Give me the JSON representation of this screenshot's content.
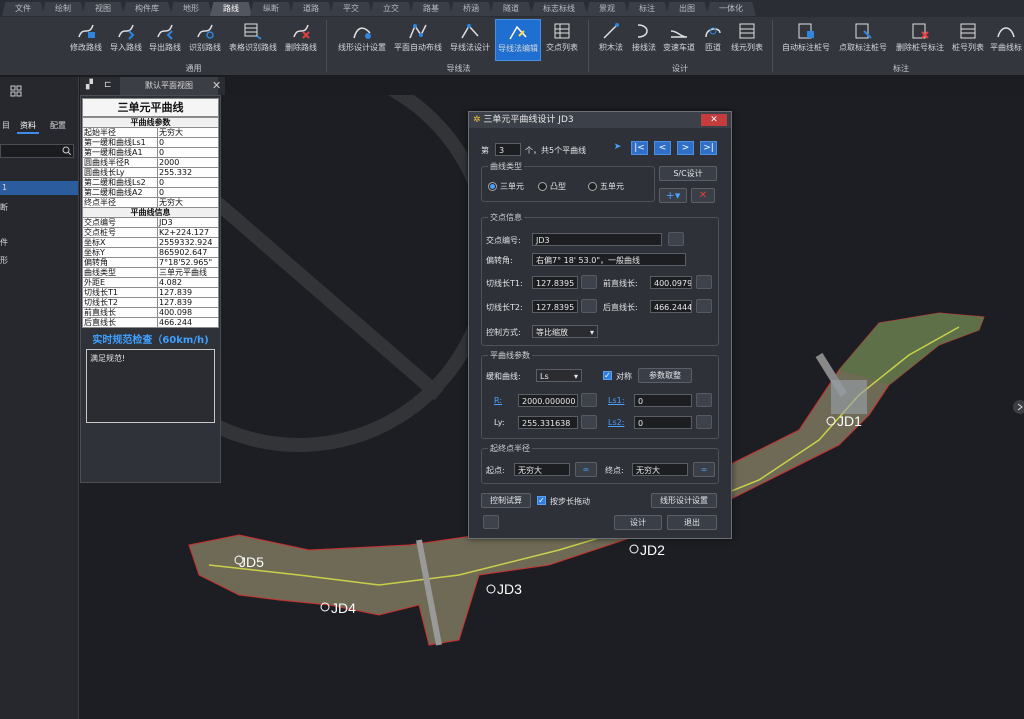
{
  "menu_tabs": [
    "文件",
    "绘制",
    "视图",
    "构件库",
    "地形",
    "路线",
    "纵断",
    "道路",
    "平交",
    "立交",
    "路基",
    "桥涵",
    "隧道",
    "标志标线",
    "景观",
    "标注",
    "出图",
    "一体化"
  ],
  "active_menu": "路线",
  "ribbon": {
    "groups": [
      {
        "label": "通用",
        "buttons": [
          "修改路线",
          "导入路线",
          "导出路线",
          "识别路线",
          "表格识别路线",
          "删除路线"
        ]
      },
      {
        "label": "导线法",
        "buttons": [
          "线形设计设置",
          "平面自动布线",
          "导线法设计",
          "导线法编辑",
          "交点列表"
        ]
      },
      {
        "label": "设计",
        "buttons": [
          "积木法",
          "接线法",
          "变速车道",
          "匝道",
          "线元列表"
        ]
      },
      {
        "label": "标注",
        "buttons": [
          "自动标注桩号",
          "点取标注桩号",
          "删除桩号标注",
          "桩号列表",
          "平曲线标"
        ]
      }
    ],
    "selected_button": "导线法编辑"
  },
  "left_panel": {
    "tabs": [
      "目",
      "资料",
      "配置"
    ],
    "active_tab": "资料",
    "items": [
      "1",
      "断",
      "件",
      "形"
    ]
  },
  "view_tab": {
    "label": "默认平面视图"
  },
  "info_panel": {
    "title": "三单元平曲线",
    "section1": "平曲线参数",
    "params": [
      [
        "起始半径",
        "无穷大"
      ],
      [
        "第一缓和曲线Ls1",
        "0"
      ],
      [
        "第一缓和曲线A1",
        "0"
      ],
      [
        "圆曲线半径R",
        "2000"
      ],
      [
        "圆曲线长Ly",
        "255.332"
      ],
      [
        "第二缓和曲线Ls2",
        "0"
      ],
      [
        "第二缓和曲线A2",
        "0"
      ],
      [
        "终点半径",
        "无穷大"
      ]
    ],
    "section2": "平曲线信息",
    "info": [
      [
        "交点编号",
        "JD3"
      ],
      [
        "交点桩号",
        "K2+224.127"
      ],
      [
        "坐标X",
        "2559332.924"
      ],
      [
        "坐标Y",
        "865902.647"
      ],
      [
        "偏转角",
        "7°18'52.965\""
      ],
      [
        "曲线类型",
        "三单元平曲线"
      ],
      [
        "外距E",
        "4.082"
      ],
      [
        "切线长T1",
        "127.839"
      ],
      [
        "切线长T2",
        "127.839"
      ],
      [
        "前直线长",
        "400.098"
      ],
      [
        "后直线长",
        "466.244"
      ]
    ],
    "check_title": "实时规范检查（60km/h)",
    "check_text": "满足规范!"
  },
  "map_labels": [
    "JD1",
    "JD2",
    "JD3",
    "JD4",
    "JD5"
  ],
  "dialog": {
    "title": "三单元平曲线设计 JD3",
    "page_prefix": "第",
    "page_value": "3",
    "page_suffix": "个，共5个平曲线",
    "curve_type_label": "曲线类型",
    "curve_types": [
      "三单元",
      "凸型",
      "五单元"
    ],
    "curve_type_selected": "三单元",
    "sc_button": "S/C设计",
    "intersection_label": "交点信息",
    "jd_label": "交点编号:",
    "jd_value": "JD3",
    "angle_label": "偏转角:",
    "angle_value": "右偏7° 18' 53.0\"，一般曲线",
    "t1_label": "切线长T1:",
    "t1_value": "127.8395",
    "front_label": "前直线长:",
    "front_value": "400.0979",
    "t2_label": "切线长T2:",
    "t2_value": "127.8395",
    "back_label": "后直线长:",
    "back_value": "466.2444",
    "control_label": "控制方式:",
    "control_value": "等比缩放",
    "curve_params_label": "平曲线参数",
    "easing_label": "缓和曲线:",
    "easing_value": "Ls",
    "symmetric_label": "对称",
    "pick_button": "参数取整",
    "r_label": "R:",
    "r_value": "2000.000000",
    "ls1_label": "Ls1:",
    "ls1_value": "0",
    "ly_label": "Ly:",
    "ly_value": "255.331638",
    "ls2_label": "Ls2:",
    "ls2_value": "0",
    "radius_section": "起终点半径",
    "start_label": "起点:",
    "start_value": "无穷大",
    "end_label": "终点:",
    "end_value": "无穷大",
    "trial_button": "控制试算",
    "drag_label": "按步长拖动",
    "settings_button": "线形设计设置",
    "design_button": "设计",
    "exit_button": "退出"
  }
}
